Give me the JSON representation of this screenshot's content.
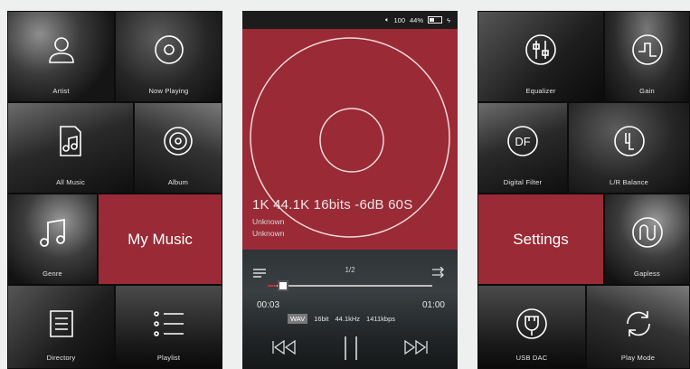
{
  "left_screen": {
    "tiles": [
      {
        "label": "Artist",
        "icon": "person-icon"
      },
      {
        "label": "Now Playing",
        "icon": "disc-icon"
      },
      {
        "label": "All Music",
        "icon": "music-file-icon"
      },
      {
        "label": "Album",
        "icon": "album-icon"
      },
      {
        "label": "Genre",
        "icon": "music-note-icon"
      },
      {
        "label": "Directory",
        "icon": "folder-list-icon"
      },
      {
        "label": "Playlist",
        "icon": "playlist-icon"
      }
    ],
    "feature": "My Music"
  },
  "player": {
    "status": {
      "volume": "100",
      "battery": "44%",
      "battery_fraction": 0.44
    },
    "spec_line": "1K 44.1K 16bits -6dB 60S",
    "artist": "Unknown",
    "album": "Unknown",
    "page": "1/2",
    "elapsed": "00:03",
    "duration": "01:00",
    "progress_fraction": 0.05,
    "format": "WAV",
    "bit_depth": "16bit",
    "sample_rate": "44.1kHz",
    "bitrate": "1411kbps"
  },
  "right_screen": {
    "tiles": [
      {
        "label": "Equalizer",
        "icon": "equalizer-icon"
      },
      {
        "label": "Gain",
        "icon": "gain-icon"
      },
      {
        "label": "Digital Filter",
        "icon": "digital-filter-icon"
      },
      {
        "label": "L/R Balance",
        "icon": "balance-icon"
      },
      {
        "label": "Gapless",
        "icon": "gapless-icon"
      },
      {
        "label": "USB DAC",
        "icon": "usb-icon"
      },
      {
        "label": "Play Mode",
        "icon": "repeat-icon"
      }
    ],
    "feature": "Settings"
  },
  "colors": {
    "accent": "#9a2a35",
    "background": "#eef0f0"
  }
}
